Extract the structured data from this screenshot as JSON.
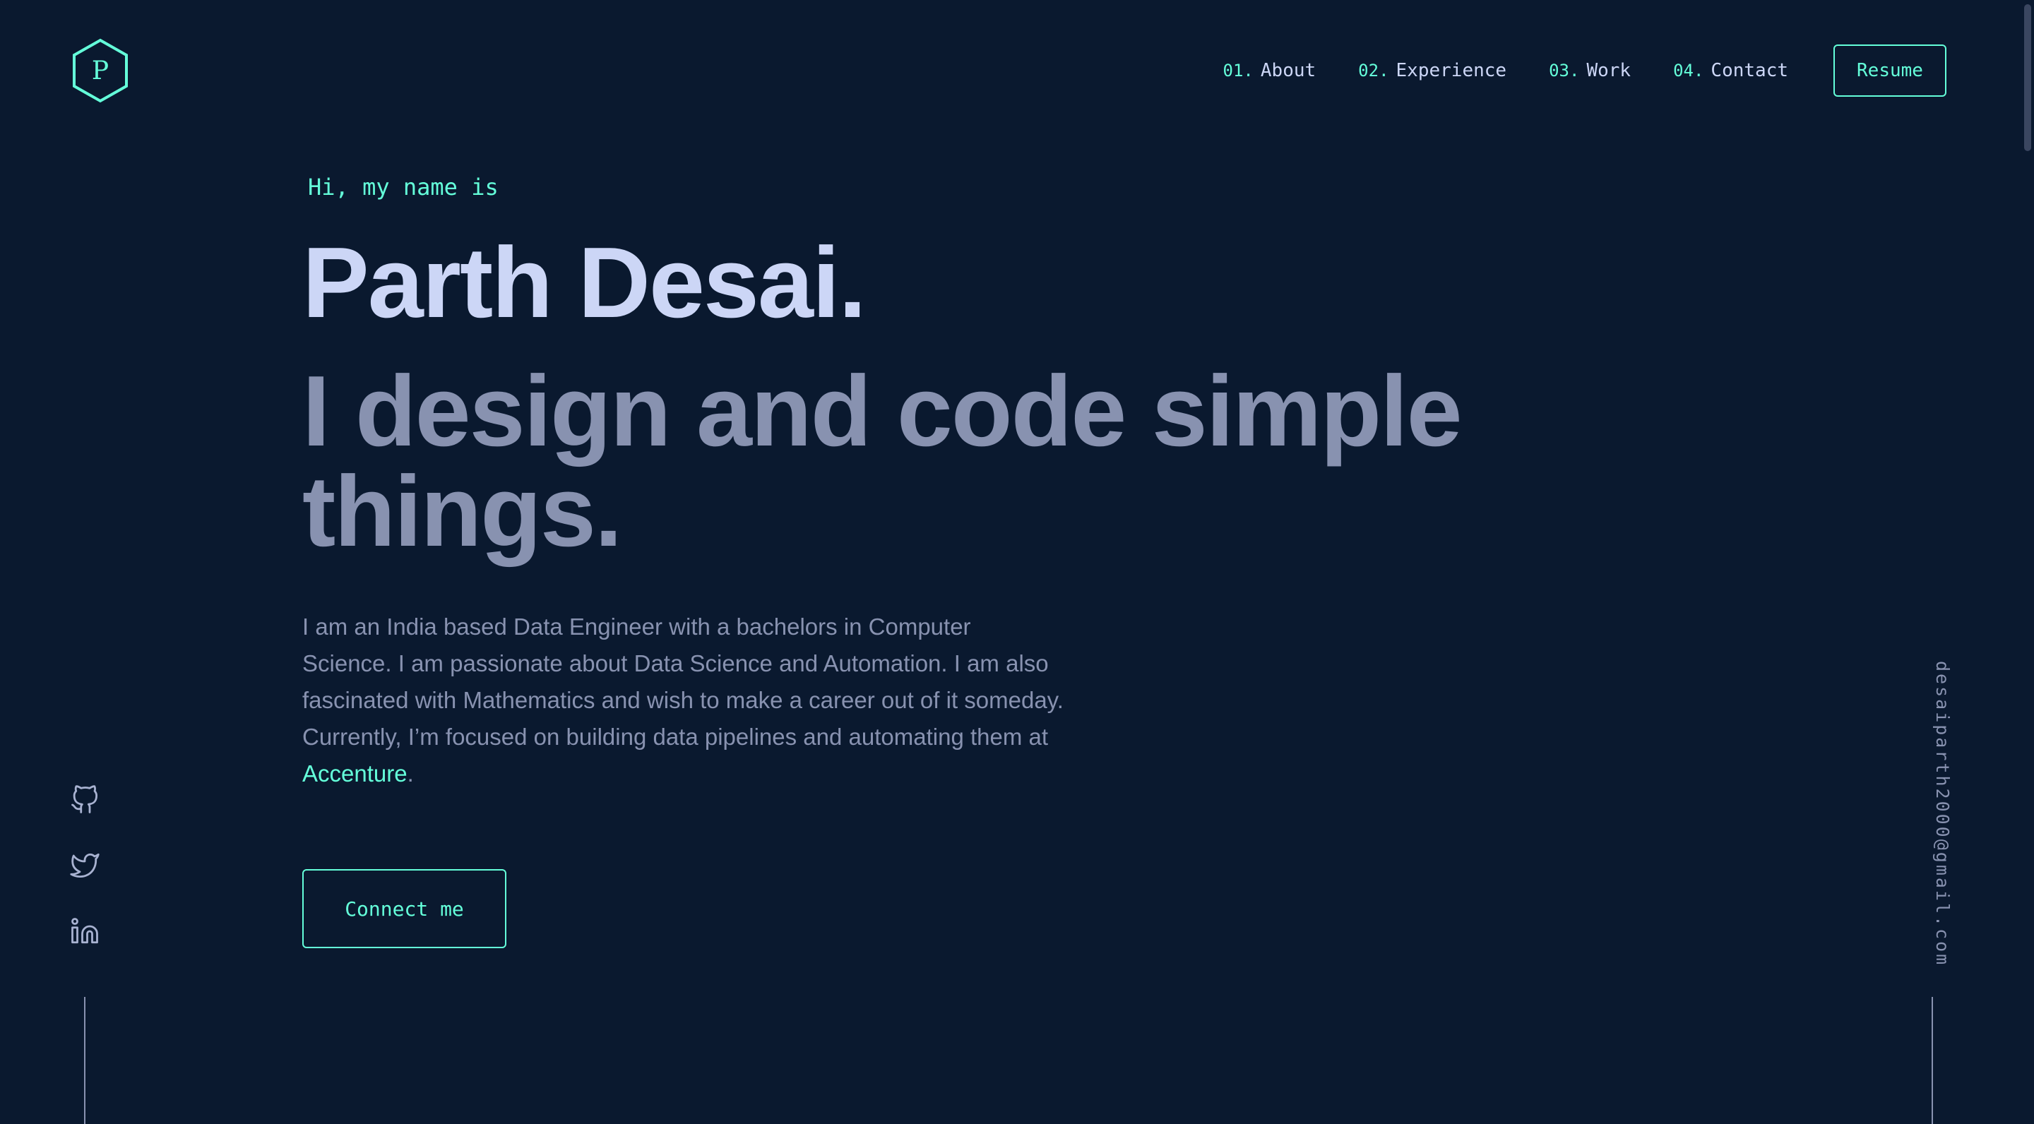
{
  "header": {
    "logo_letter": "P",
    "nav": [
      {
        "num": "01.",
        "label": "About"
      },
      {
        "num": "02.",
        "label": "Experience"
      },
      {
        "num": "03.",
        "label": "Work"
      },
      {
        "num": "04.",
        "label": "Contact"
      }
    ],
    "resume_label": "Resume"
  },
  "hero": {
    "greeting": "Hi, my name is",
    "name": "Parth Desai.",
    "tagline": "I design and code simple things.",
    "bio_text": "I am an India based Data Engineer with a bachelors in Computer Science. I am passionate about Data Science and Automation. I am also fascinated with Mathematics and wish to make a career out of it someday. Currently, I’m focused on building data pipelines and automating them at ",
    "bio_link": "Accenture",
    "bio_end": ".",
    "cta_label": "Connect me"
  },
  "socials": [
    {
      "icon": "github-icon"
    },
    {
      "icon": "twitter-icon"
    },
    {
      "icon": "linkedin-icon"
    }
  ],
  "email": "desaiparth2000@gmail.com",
  "colors": {
    "background": "#0a192f",
    "accent": "#64ffda",
    "heading": "#ccd6f6",
    "text": "#8892b0"
  }
}
